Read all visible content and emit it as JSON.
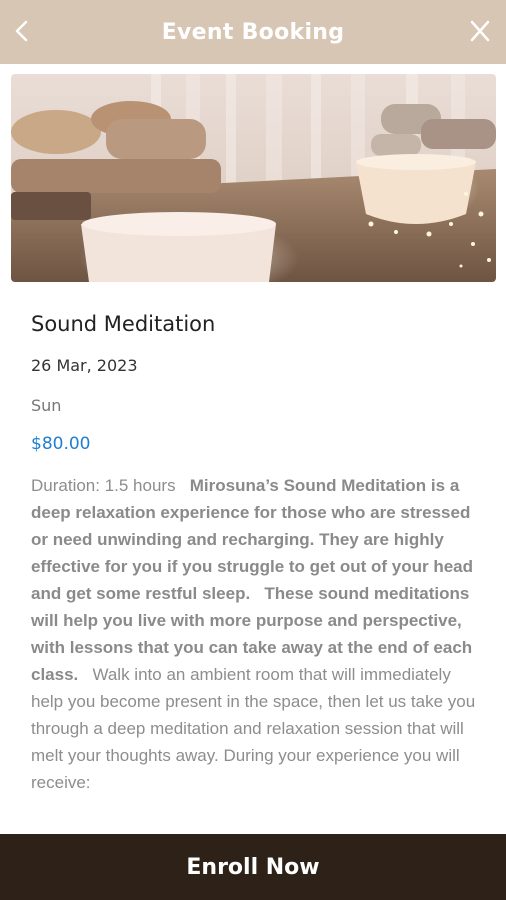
{
  "header": {
    "title": "Event Booking",
    "back_icon": "chevron-left-icon",
    "close_icon": "close-icon",
    "background": "#d8c6b4"
  },
  "event": {
    "title": "Sound Meditation",
    "date": "26 Mar, 2023",
    "day": "Sun",
    "price": "$80.00",
    "price_color": "#1f7fd2",
    "description": {
      "part1": "Duration: 1.5 hours",
      "bold1": "Mirosuna’s Sound Meditation is a deep relaxation experience for those who are stressed or need unwinding and recharging. They are highly effective for you if you struggle to get out of your head and get some restful sleep.",
      "bold2": "These sound meditations will help you live with more purpose and perspective, with lessons that you can take away at the end of each class.",
      "part2": "Walk into an ambient room that will immediately help you become present in the space, then let us take you through a deep meditation and relaxation session that will melt your thoughts away. During your experience you will receive:"
    }
  },
  "footer": {
    "enroll_label": "Enroll Now",
    "background": "#2e2218"
  }
}
